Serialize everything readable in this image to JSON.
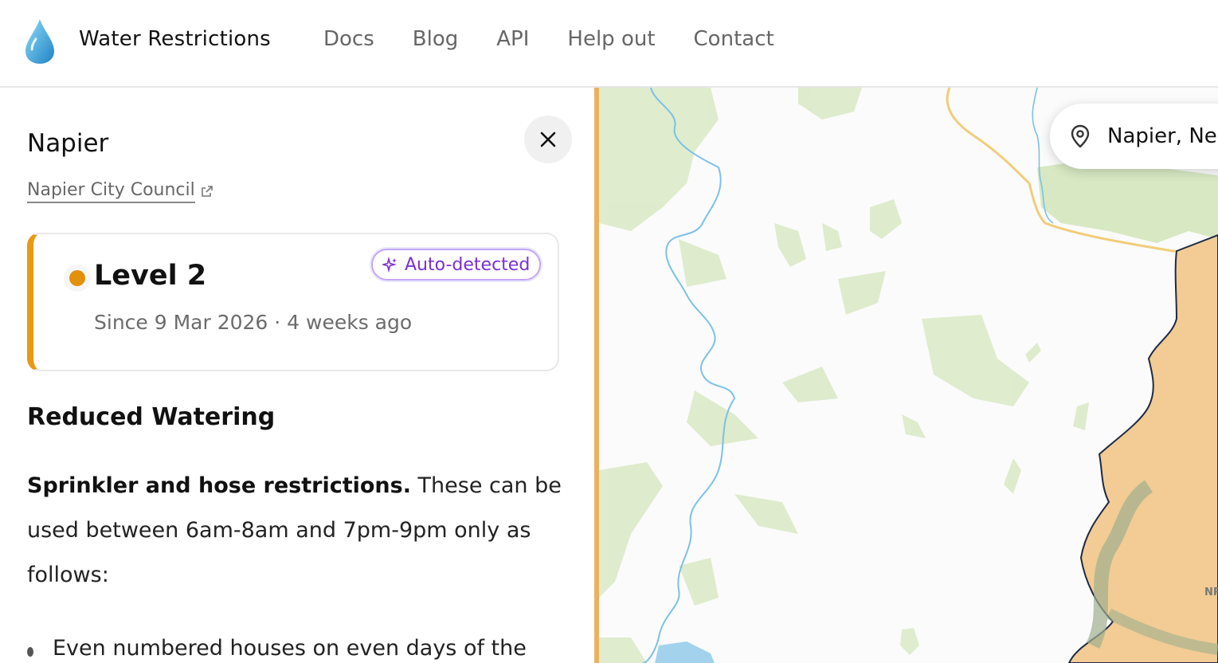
{
  "header": {
    "brand": "Water Restrictions",
    "logo_icon": "water-drop-icon",
    "nav": [
      "Docs",
      "Blog",
      "API",
      "Help out",
      "Contact"
    ]
  },
  "panel": {
    "place_title": "Napier",
    "council_link": "Napier City Council",
    "close_icon": "close-icon",
    "level": {
      "title": "Level 2",
      "since": "Since 9 Mar 2026 · 4 weeks ago",
      "badge": "Auto-detected",
      "status_color": "#e3910a"
    },
    "section_heading": "Reduced Watering",
    "paragraph_bold": "Sprinkler and hose restrictions.",
    "paragraph_rest": " These can be used between 6am-8am and 7pm-9pm only as follows:",
    "bullets": [
      "Even numbered houses on even days of the"
    ]
  },
  "map": {
    "search_value": "Napier, New",
    "search_icon": "map-pin-icon",
    "marker_label": "NP",
    "colors": {
      "restriction_area": "#f2cc94",
      "forest": "#dbeac9",
      "river": "#7cc1e6",
      "road": "#f1cd7a"
    }
  }
}
